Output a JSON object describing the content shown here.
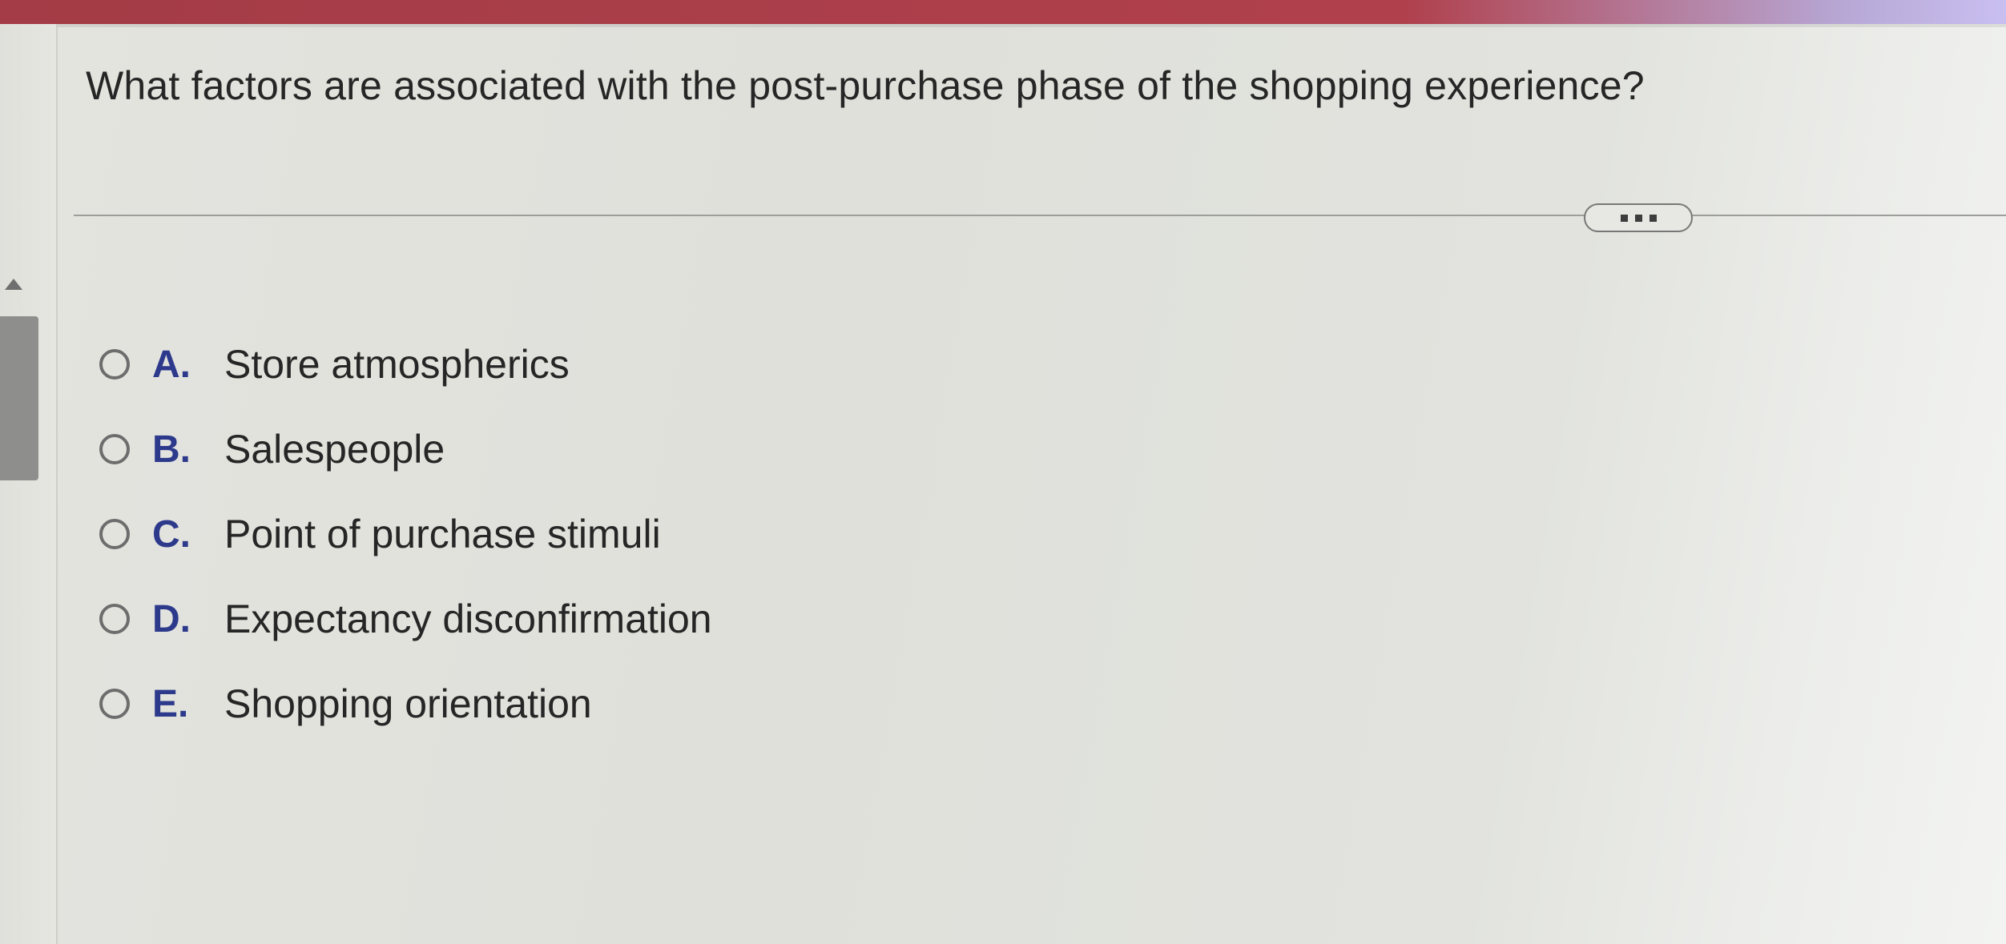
{
  "question": {
    "text": "What factors are associated with the post-purchase phase of the shopping experience?"
  },
  "more_button": {
    "icon": "more-dots-icon"
  },
  "options": [
    {
      "letter": "A.",
      "text": "Store atmospherics",
      "selected": false
    },
    {
      "letter": "B.",
      "text": "Salespeople",
      "selected": false
    },
    {
      "letter": "C.",
      "text": "Point of purchase stimuli",
      "selected": false
    },
    {
      "letter": "D.",
      "text": "Expectancy disconfirmation",
      "selected": false
    },
    {
      "letter": "E.",
      "text": "Shopping orientation",
      "selected": false
    }
  ],
  "colors": {
    "header": "#b0404c",
    "option_letter": "#2d3a8c",
    "text": "#262626"
  }
}
